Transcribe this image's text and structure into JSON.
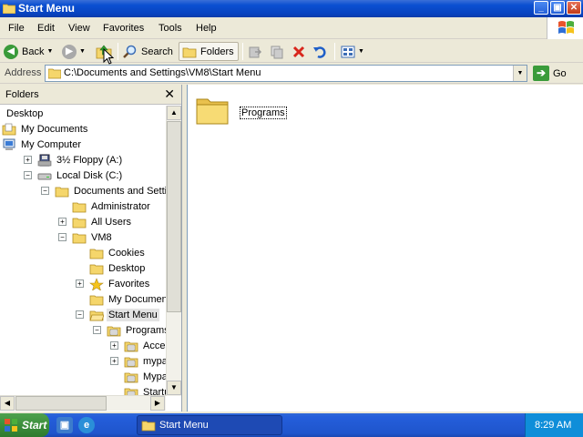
{
  "window": {
    "title": "Start Menu",
    "buttons": {
      "minimize": "_",
      "maximize": "▣",
      "close": "✕"
    }
  },
  "menubar": {
    "items": [
      "File",
      "Edit",
      "View",
      "Favorites",
      "Tools",
      "Help"
    ]
  },
  "toolbar": {
    "back": "Back",
    "search": "Search",
    "folders": "Folders"
  },
  "address": {
    "label": "Address",
    "value": "C:\\Documents and Settings\\VM8\\Start Menu",
    "go": "Go"
  },
  "folders_pane": {
    "title": "Folders",
    "close": "✕",
    "tree": [
      {
        "label": "Desktop",
        "expander": "",
        "icon": "desktop-icon"
      },
      {
        "label": "My Documents",
        "expander": "",
        "icon": "my-documents-icon"
      },
      {
        "label": "My Computer",
        "expander": "",
        "icon": "my-computer-icon"
      },
      {
        "label": "3½ Floppy (A:)",
        "expander": "+",
        "icon": "floppy-icon"
      },
      {
        "label": "Local Disk (C:)",
        "expander": "−",
        "icon": "hard-disk-icon"
      },
      {
        "label": "Documents and Settings",
        "expander": "−",
        "icon": "folder-icon"
      },
      {
        "label": "Administrator",
        "expander": "",
        "icon": "folder-icon"
      },
      {
        "label": "All Users",
        "expander": "+",
        "icon": "folder-icon"
      },
      {
        "label": "VM8",
        "expander": "−",
        "icon": "folder-icon"
      },
      {
        "label": "Cookies",
        "expander": "",
        "icon": "folder-icon"
      },
      {
        "label": "Desktop",
        "expander": "",
        "icon": "folder-icon"
      },
      {
        "label": "Favorites",
        "expander": "+",
        "icon": "favorites-star-icon"
      },
      {
        "label": "My Documents",
        "expander": "",
        "icon": "folder-icon"
      },
      {
        "label": "Start Menu",
        "expander": "−",
        "icon": "folder-open-icon",
        "selected": true
      },
      {
        "label": "Programs",
        "expander": "−",
        "icon": "program-folder-icon"
      },
      {
        "label": "Accessori",
        "expander": "+",
        "icon": "program-folder-icon"
      },
      {
        "label": "mypal",
        "expander": "+",
        "icon": "program-folder-icon"
      },
      {
        "label": "Mypal Bro",
        "expander": "",
        "icon": "program-folder-icon"
      },
      {
        "label": "Startup",
        "expander": "",
        "icon": "program-folder-icon"
      }
    ]
  },
  "content": {
    "items": [
      {
        "label": "Programs",
        "icon": "folder-icon"
      }
    ]
  },
  "taskbar": {
    "start": "Start",
    "task": "Start Menu",
    "clock": "8:29 AM"
  }
}
